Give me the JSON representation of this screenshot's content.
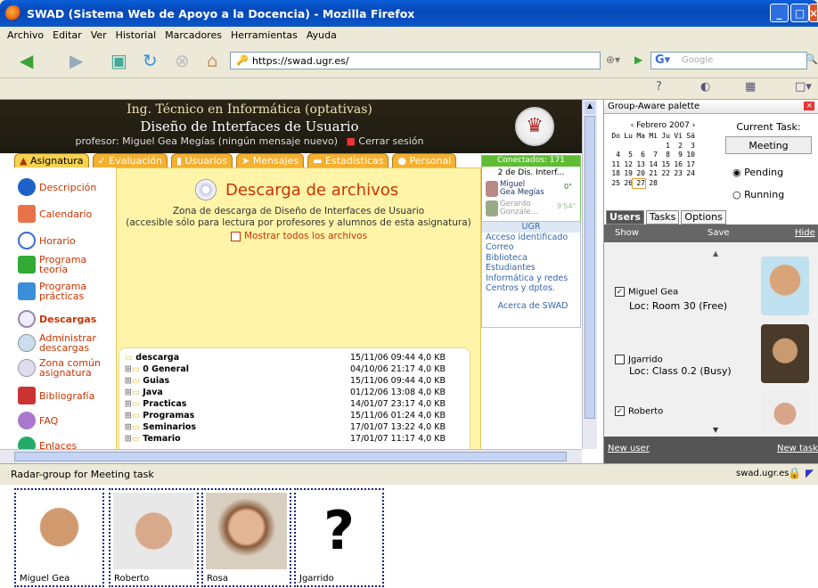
{
  "window": {
    "title": "SWAD (Sistema Web de Apoyo a la Docencia) - Mozilla Firefox"
  },
  "menu": [
    "Archivo",
    "Editar",
    "Ver",
    "Historial",
    "Marcadores",
    "Herramientas",
    "Ayuda"
  ],
  "address": {
    "url": "https://swad.ugr.es/"
  },
  "search": {
    "placeholder": "Google"
  },
  "header": {
    "subtitle": "Ing. Técnico en Informática (optativas)",
    "title": "Diseño de Interfaces de Usuario",
    "professor": "profesor: Miguel Gea Megías",
    "messages": "(ningún mensaje nuevo)",
    "logout": "Cerrar sesión"
  },
  "tabs": [
    "Asignatura",
    "Evaluación",
    "Usuarios",
    "Mensajes",
    "Estadísticas",
    "Personal"
  ],
  "sidebar": [
    "Descripción",
    "Calendario",
    "Horario",
    "Programa teoría",
    "Programa prácticas",
    "Descargas",
    "Administrar descargas",
    "Zona común asignatura",
    "Bibliografía",
    "FAQ",
    "Enlaces"
  ],
  "main": {
    "title": "Descarga de archivos",
    "desc1": "Zona de descarga de Diseño de Interfaces de Usuario",
    "desc2": "(accesible sólo para lectura por profesores y alumnos de esta asignatura)",
    "show_all": "Mostrar todos los archivos",
    "files": [
      {
        "name": "descarga",
        "date": "15/11/06 09:44",
        "size": "4,0 KB"
      },
      {
        "name": "0 General",
        "date": "04/10/06 21:17",
        "size": "4,0 KB"
      },
      {
        "name": "Guias",
        "date": "15/11/06 09:44",
        "size": "4,0 KB"
      },
      {
        "name": "Java",
        "date": "01/12/06 13:08",
        "size": "4,0 KB"
      },
      {
        "name": "Practicas",
        "date": "14/01/07 23:17",
        "size": "4,0 KB"
      },
      {
        "name": "Programas",
        "date": "15/11/06 01:24",
        "size": "4,0 KB"
      },
      {
        "name": "Seminarios",
        "date": "17/01/07 13:22",
        "size": "4,0 KB"
      },
      {
        "name": "Temario",
        "date": "17/01/07 11:17",
        "size": "4,0 KB"
      }
    ]
  },
  "connected": {
    "header": "Conectados: 171",
    "line": "2 de Dis. Interf...",
    "users": [
      {
        "name1": "Miguel",
        "name2": "Gea Megías",
        "time": "0\""
      },
      {
        "name1": "Gerardo",
        "name2": "Gonzále...",
        "time": "9'54\""
      }
    ]
  },
  "ugr": {
    "header": "UGR",
    "links": [
      "Acceso identificado",
      "Correo",
      "Biblioteca",
      "Estudiantes",
      "Informática y redes",
      "Centros y dptos."
    ],
    "about": "Acerca de SWAD"
  },
  "palette": {
    "title": "Group-Aware palette",
    "calendar": {
      "month": "Febrero 2007",
      "days": [
        "Do",
        "Lu",
        "Ma",
        "Mi",
        "Ju",
        "Vi",
        "Sá"
      ],
      "weeks": [
        [
          "",
          "",
          "",
          "",
          "1",
          "2",
          "3"
        ],
        [
          "4",
          "5",
          "6",
          "7",
          "8",
          "9",
          "10"
        ],
        [
          "11",
          "12",
          "13",
          "14",
          "15",
          "16",
          "17"
        ],
        [
          "18",
          "19",
          "20",
          "21",
          "22",
          "23",
          "24"
        ],
        [
          "25",
          "26",
          "27",
          "28",
          "",
          "",
          ""
        ]
      ]
    },
    "current_task_label": "Current Task:",
    "current_task": "Meeting",
    "pending": "Pending",
    "running": "Running",
    "tabs": [
      "Users",
      "Tasks",
      "Options"
    ],
    "toolbar": {
      "show": "Show",
      "save": "Save",
      "hide": "Hide"
    },
    "users": [
      {
        "name": "Miguel Gea",
        "loc": "Loc: Room 30 (Free)",
        "checked": true
      },
      {
        "name": "Jgarrido",
        "loc": "Loc: Class 0.2 (Busy)",
        "checked": false
      },
      {
        "name": "Roberto",
        "loc": "",
        "checked": true
      }
    ],
    "new_user": "New user",
    "new_task": "New task"
  },
  "radar": {
    "title": "Radar-group for Meeting task",
    "status_host": "swad.ugr.es",
    "members": [
      "Miguel Gea",
      "Roberto",
      "Rosa",
      "Jgarrido"
    ]
  }
}
